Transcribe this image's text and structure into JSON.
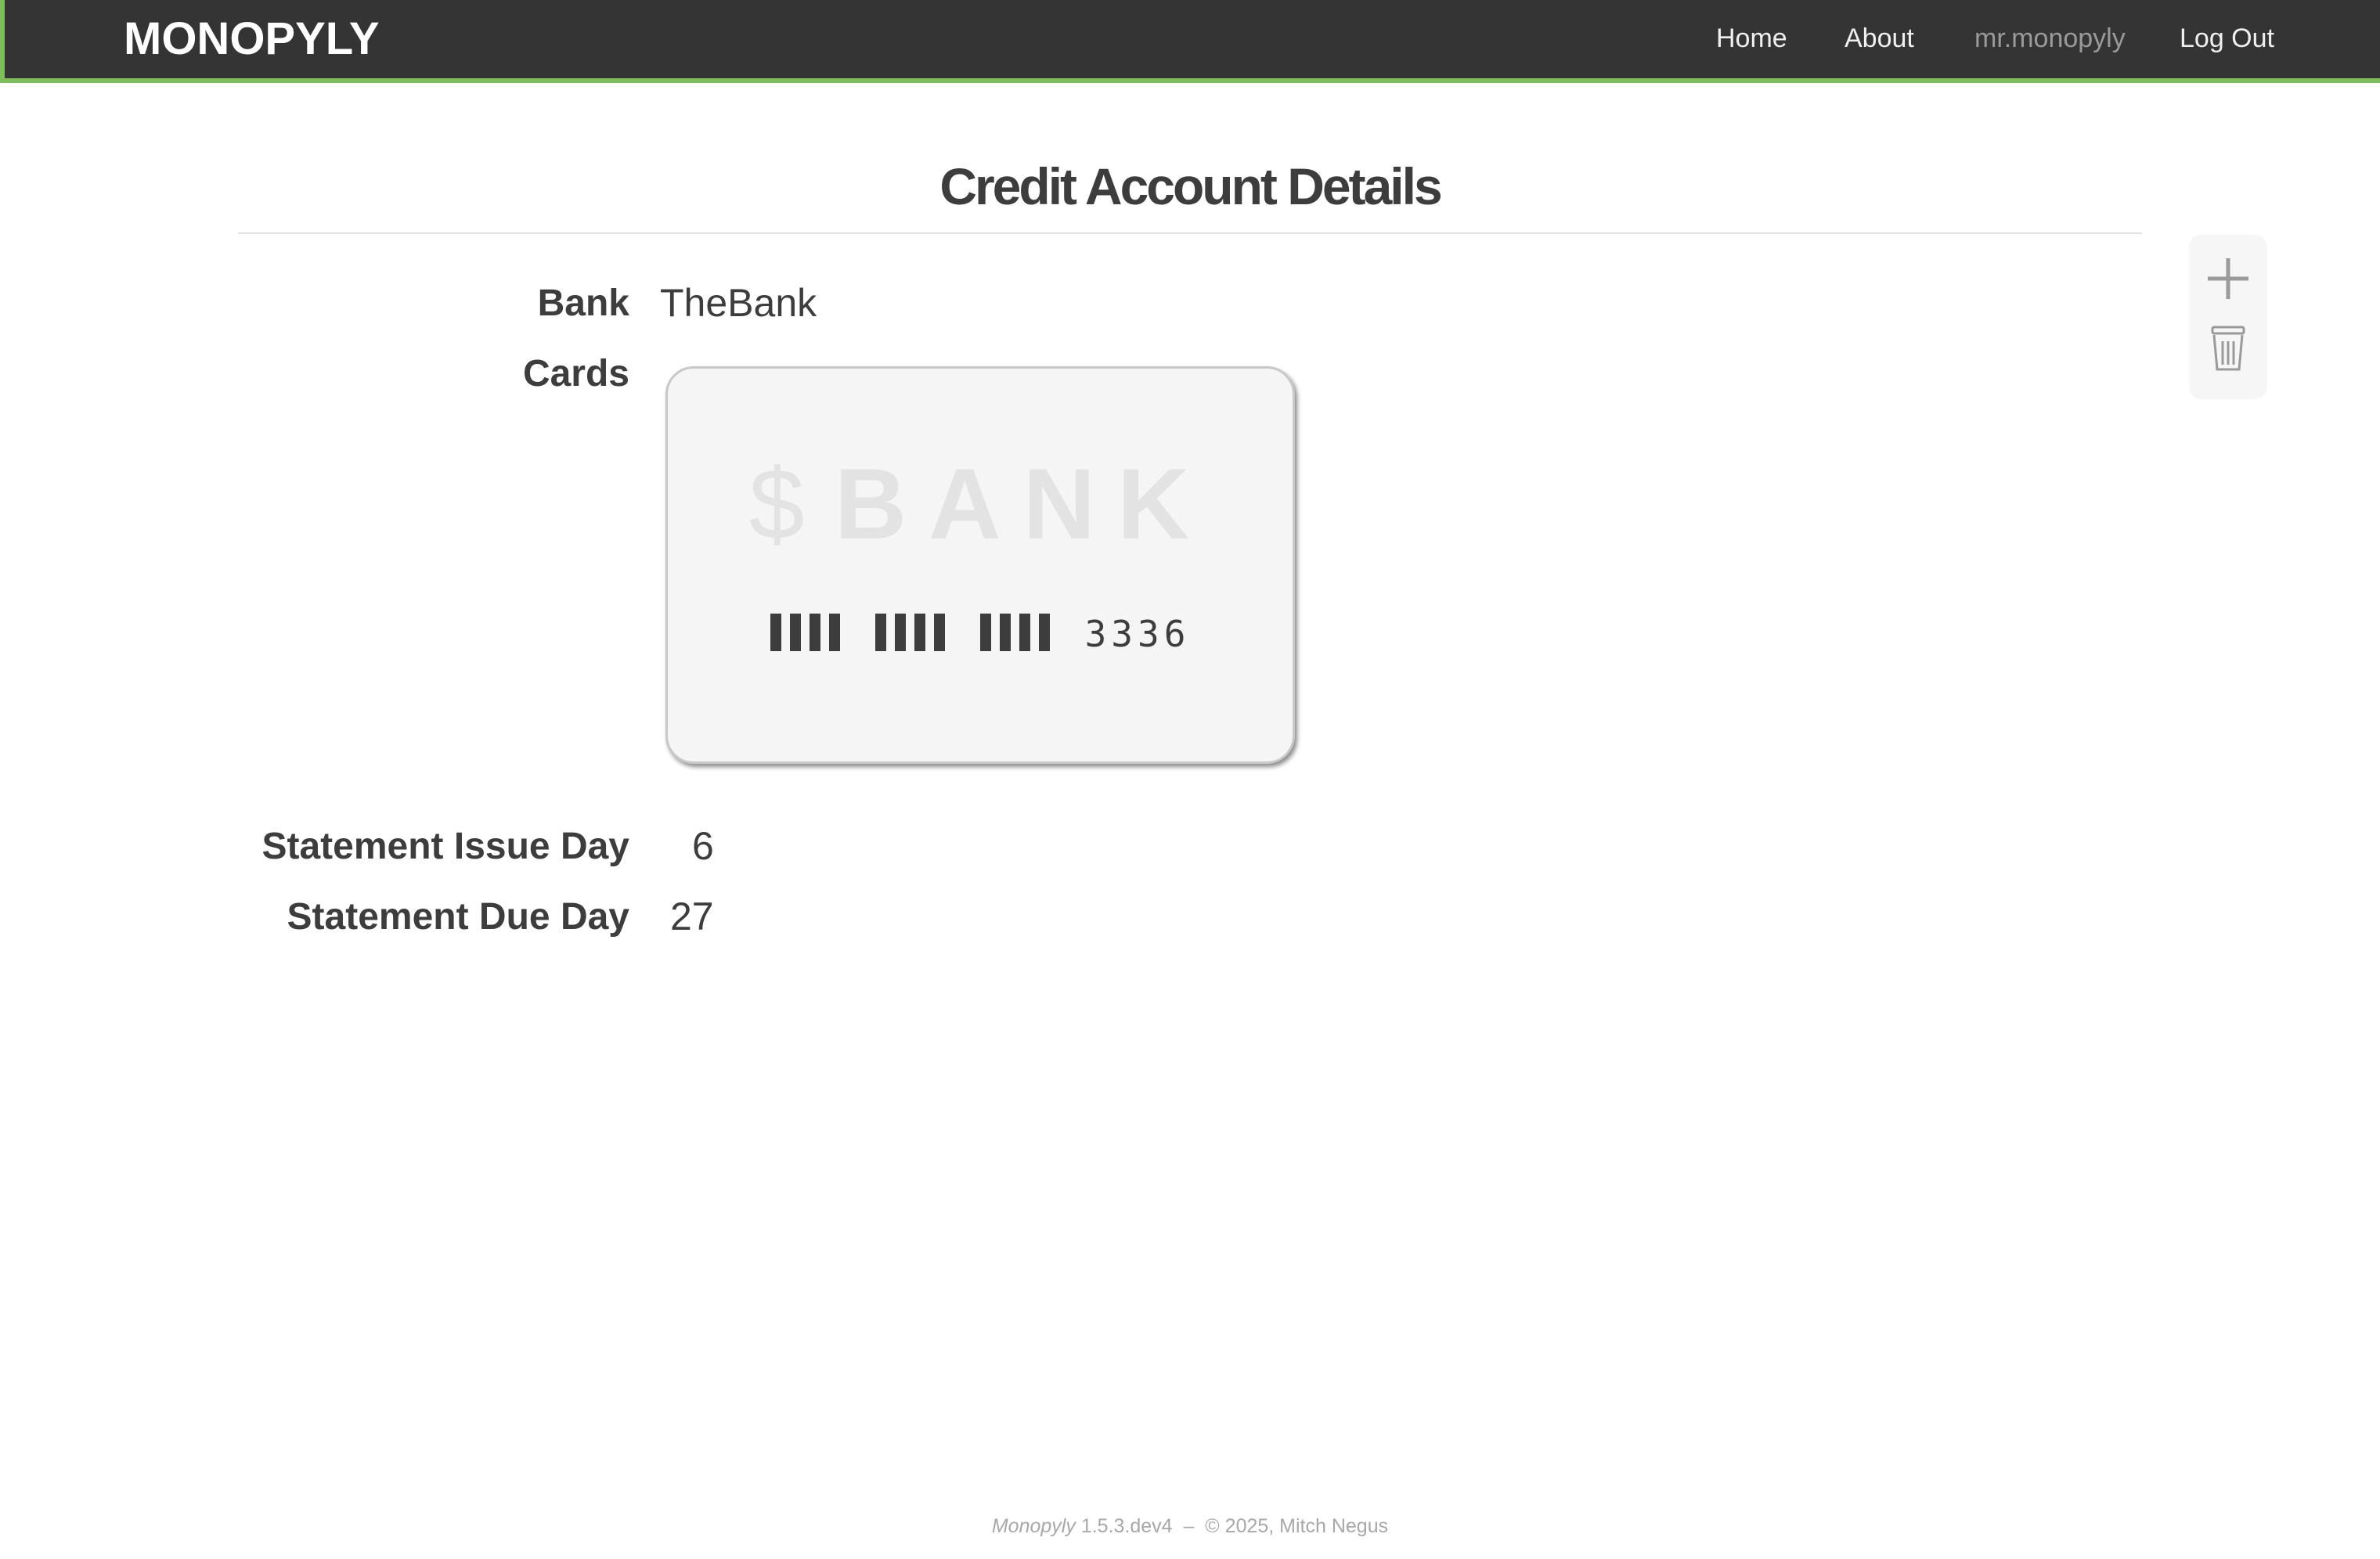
{
  "nav": {
    "brand": "MONOPYLY",
    "links": [
      {
        "label": "Home"
      },
      {
        "label": "About"
      },
      {
        "label": "mr.monopyly"
      },
      {
        "label": "Log Out"
      }
    ]
  },
  "page": {
    "title": "Credit Account Details"
  },
  "details": {
    "bank_label": "Bank",
    "bank_value": "TheBank",
    "cards_label": "Cards",
    "issue_day_label": "Statement Issue Day",
    "issue_day_value": "6",
    "due_day_label": "Statement Due Day",
    "due_day_value": "27"
  },
  "card": {
    "dollar": "$",
    "bank_text": "BANK",
    "last_four": "3336"
  },
  "actions": {
    "add_icon": "plus-icon",
    "delete_icon": "trash-icon"
  },
  "footer": {
    "app_name": "Monopyly",
    "version": "1.5.3.dev4",
    "separator": "–",
    "copyright": "© 2025, Mitch Negus"
  },
  "colors": {
    "navbar": "#343434",
    "accent": "#7dbf5a",
    "text": "#3d3d3d"
  }
}
